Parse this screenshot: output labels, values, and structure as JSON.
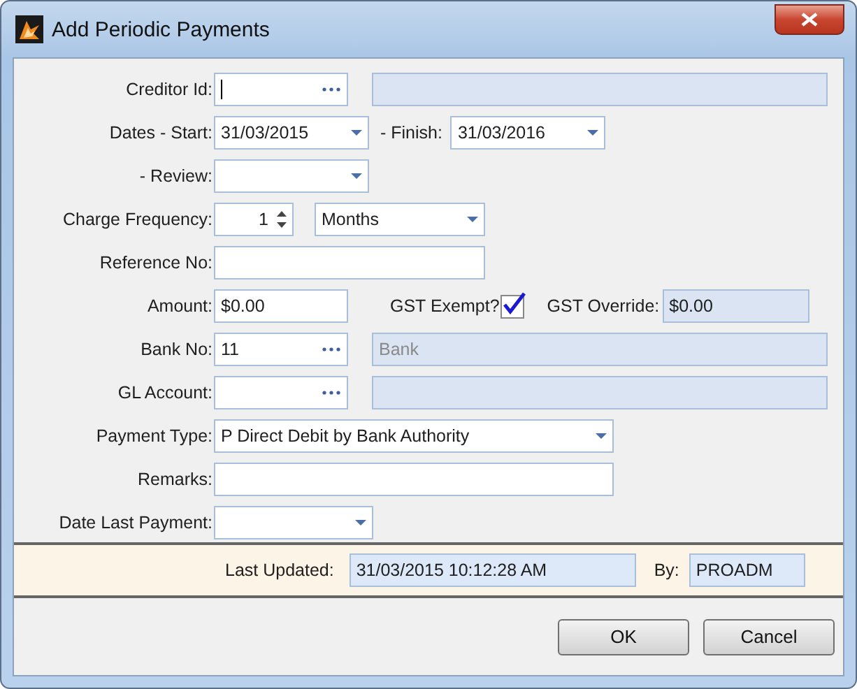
{
  "window": {
    "title": "Add Periodic Payments"
  },
  "rows": [
    {
      "label": "Creditor Id:",
      "controls": [
        {
          "kind": "lookup",
          "focused": true
        },
        {
          "kind": "readonly"
        }
      ]
    },
    {
      "label": "Dates - Start:",
      "controls": [
        {
          "kind": "date",
          "value": "31/03/2015"
        },
        {
          "kind": "label",
          "text": "- Finish:"
        },
        {
          "kind": "date",
          "value": "31/03/2016"
        }
      ]
    },
    {
      "label": "- Review:",
      "controls": [
        {
          "kind": "date"
        }
      ]
    },
    {
      "label": "Charge Frequency:",
      "controls": [
        {
          "kind": "spin",
          "value": "1"
        },
        {
          "kind": "combo",
          "value": "Months"
        }
      ]
    },
    {
      "label": "Reference No:",
      "controls": [
        {
          "kind": "text"
        }
      ]
    },
    {
      "label": "Amount:",
      "controls": [
        {
          "kind": "text",
          "value": "$0.00"
        },
        {
          "kind": "label",
          "text": "GST Exempt?"
        },
        {
          "kind": "checkbox",
          "checked": true
        },
        {
          "kind": "label",
          "text": "GST Override:"
        },
        {
          "kind": "readonly",
          "value": "$0.00"
        }
      ]
    },
    {
      "label": "Bank No:",
      "controls": [
        {
          "kind": "lookup",
          "value": "11"
        },
        {
          "kind": "readonly",
          "placeholder": "Bank"
        }
      ]
    },
    {
      "label": "GL Account:",
      "controls": [
        {
          "kind": "lookup"
        },
        {
          "kind": "readonly"
        }
      ]
    },
    {
      "label": "Payment Type:",
      "controls": [
        {
          "kind": "combo",
          "value": "P Direct Debit by Bank Authority"
        }
      ]
    },
    {
      "label": "Remarks:",
      "controls": [
        {
          "kind": "text"
        }
      ]
    },
    {
      "label": "Date Last Payment:",
      "controls": [
        {
          "kind": "date"
        }
      ]
    }
  ],
  "footer": {
    "last_updated_label": "Last Updated:",
    "last_updated": "31/03/2015 10:12:28 AM",
    "by_label": "By:",
    "by": "PROADM"
  },
  "buttons": [
    "OK",
    "Cancel"
  ]
}
